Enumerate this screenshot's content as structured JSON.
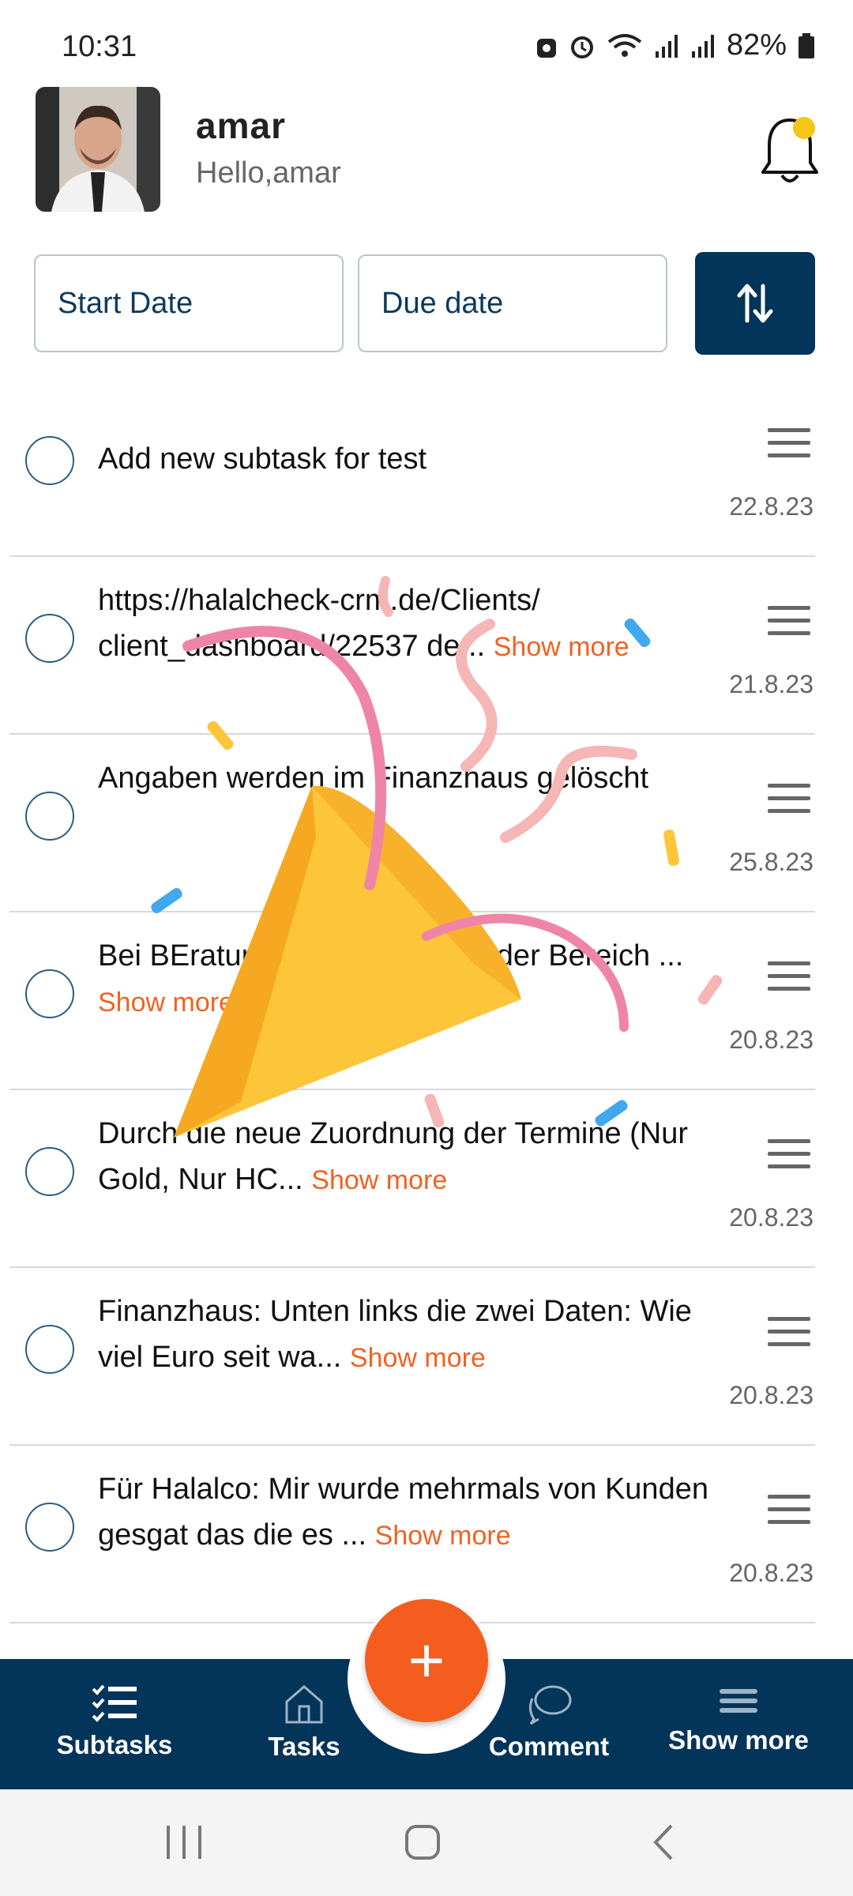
{
  "status_bar": {
    "time": "10:31",
    "battery": "82%"
  },
  "header": {
    "user_name": "amar",
    "greeting": "Hello,amar",
    "has_notification": true
  },
  "filters": {
    "start_placeholder": "Start Date",
    "due_placeholder": "Due date"
  },
  "tasks": [
    {
      "text": "Add new subtask for test",
      "show_more": "",
      "date": "22.8.23"
    },
    {
      "text": "https://halalcheck-crm.de/Clients/ client_dashboard/22537 de...",
      "show_more": "Show more",
      "date": "21.8.23"
    },
    {
      "text": "Angaben werden im Finanzhaus gelöscht",
      "show_more": "",
      "date": "25.8.23"
    },
    {
      "text": "Bei BEratung oder Rückruf ... der Bereich ...",
      "show_more": "Show more",
      "date": "20.8.23"
    },
    {
      "text": "Durch die neue Zuordnung der Termine (Nur Gold, Nur HC...",
      "show_more": "Show more",
      "date": "20.8.23"
    },
    {
      "text": "Finanzhaus: Unten links die zwei Daten: Wie viel Euro seit wa...",
      "show_more": "Show more",
      "date": "20.8.23"
    },
    {
      "text": "Für Halalco: Mir wurde mehrmals von Kunden gesgat das die es ...",
      "show_more": "Show more",
      "date": "20.8.23"
    }
  ],
  "bottom_nav": {
    "subtasks": "Subtasks",
    "tasks": "Tasks",
    "fab": "+",
    "comment": "Comment",
    "show_more": "Show more"
  },
  "colors": {
    "primary": "#033459",
    "accent": "#f45d1d",
    "show_more": "#f06221"
  }
}
